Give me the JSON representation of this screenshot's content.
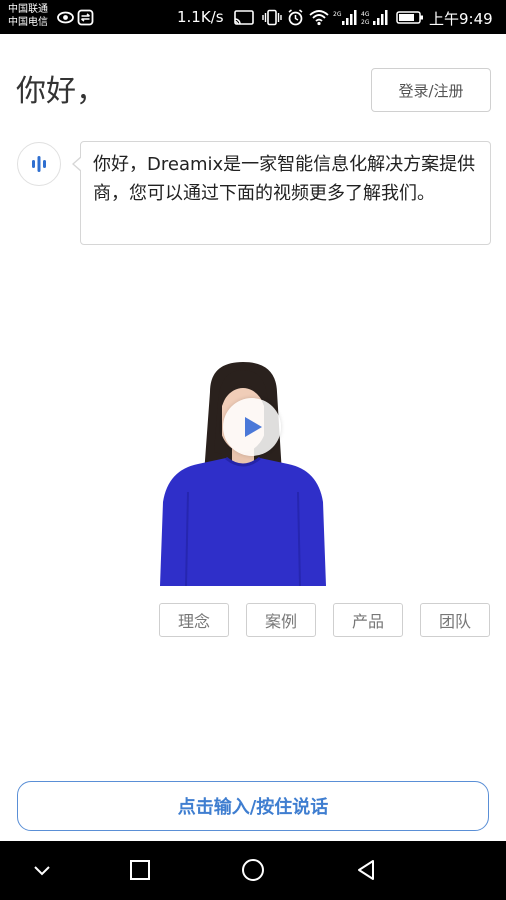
{
  "status_bar": {
    "carrier_1": "中国联通",
    "carrier_2": "中国电信",
    "net_speed": "1.1K/s",
    "time": "上午9:49",
    "icons": [
      "eye-icon",
      "sync-icon",
      "cast-icon",
      "vibrate-icon",
      "alarm-icon",
      "wifi-icon",
      "signal-2g-icon",
      "signal-4g-icon",
      "battery-icon"
    ]
  },
  "header": {
    "greeting": "你好，",
    "login_label": "登录/注册"
  },
  "bot_message": {
    "avatar_icon": "voice-wave-icon",
    "text": "你好，Dreamix是一家智能信息化解决方案提供商，您可以通过下面的视频更多了解我们。"
  },
  "video": {
    "play_icon": "play-icon"
  },
  "topics": [
    {
      "label": "理念"
    },
    {
      "label": "案例"
    },
    {
      "label": "产品"
    },
    {
      "label": "团队"
    }
  ],
  "input_bar": {
    "label": "点击输入/按住说话"
  },
  "nav_bar": {
    "icons": [
      "chevron-down-icon",
      "recents-icon",
      "home-icon",
      "back-icon"
    ]
  },
  "colors": {
    "accent": "#3f7ed0",
    "shirt": "#2f2fc9",
    "play": "#4a78d8"
  }
}
